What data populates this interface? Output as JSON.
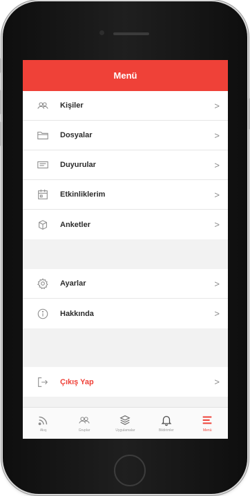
{
  "header": {
    "title": "Menü"
  },
  "groups": [
    [
      {
        "label": "Kişiler",
        "icon": "people-icon",
        "chevron": ">"
      },
      {
        "label": "Dosyalar",
        "icon": "folder-icon",
        "chevron": ">"
      },
      {
        "label": "Duyurular",
        "icon": "announcement-icon",
        "chevron": ">"
      },
      {
        "label": "Etkinliklerim",
        "icon": "calendar-icon",
        "chevron": ">"
      },
      {
        "label": "Anketler",
        "icon": "survey-icon",
        "chevron": ">"
      }
    ],
    [
      {
        "label": "Ayarlar",
        "icon": "gear-icon",
        "chevron": ">"
      },
      {
        "label": "Hakkında",
        "icon": "info-icon",
        "chevron": ">"
      }
    ],
    [
      {
        "label": "Çıkış Yap",
        "icon": "logout-icon",
        "chevron": ">"
      }
    ]
  ],
  "tabs": [
    {
      "label": "Akış",
      "icon": "feed-icon",
      "active": false
    },
    {
      "label": "Gruplar",
      "icon": "groups-icon",
      "active": false
    },
    {
      "label": "Uygulamalar",
      "icon": "apps-icon",
      "active": false
    },
    {
      "label": "Bildirimler",
      "icon": "bell-icon",
      "active": false
    },
    {
      "label": "Menü",
      "icon": "menu-icon",
      "active": true
    }
  ],
  "colors": {
    "accent": "#ef4138",
    "text": "#2b2b2b",
    "muted": "#9a9a9a",
    "background": "#f2f2f2"
  }
}
